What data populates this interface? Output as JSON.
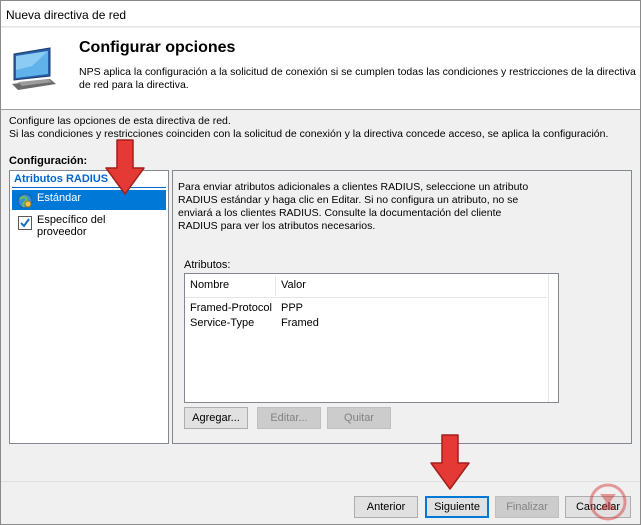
{
  "window": {
    "title": "Nueva directiva de red"
  },
  "header": {
    "title": "Configurar opciones",
    "description": "NPS aplica la configuración a la solicitud de conexión si se cumplen todas las condiciones y restricciones de la directiva de red para la directiva.",
    "icon": "monitor-network-icon"
  },
  "intro": {
    "line1": "Configure las opciones de esta directiva de red.",
    "line2": "Si las condiciones y restricciones coinciden con la solicitud de conexión y la directiva concede acceso, se aplica la configuración."
  },
  "config": {
    "label": "Configuración:",
    "section_header": "Atributos RADIUS",
    "items": [
      {
        "label": "Estándar",
        "icon": "globe-icon",
        "selected": true
      },
      {
        "label": "Específico del proveedor",
        "icon": "checkbox-checked-icon",
        "selected": false
      }
    ]
  },
  "panel": {
    "description": "Para enviar atributos adicionales a clientes RADIUS, seleccione un atributo RADIUS estándar y haga clic en Editar. Si no configura un atributo, no se enviará a los clientes RADIUS. Consulte la documentación del cliente RADIUS para ver los atributos necesarios.",
    "attributes_label": "Atributos:",
    "columns": [
      "Nombre",
      "Valor"
    ],
    "rows": [
      {
        "name": "Framed-Protocol",
        "value": "PPP"
      },
      {
        "name": "Service-Type",
        "value": "Framed"
      }
    ],
    "buttons": {
      "add": "Agregar...",
      "edit": "Editar...",
      "remove": "Quitar"
    }
  },
  "footer": {
    "back": "Anterior",
    "next": "Siguiente",
    "finish": "Finalizar",
    "cancel": "Cancelar"
  },
  "colors": {
    "selection": "#0078d7",
    "section_header": "#0066cc",
    "arrow": "#e53935"
  }
}
